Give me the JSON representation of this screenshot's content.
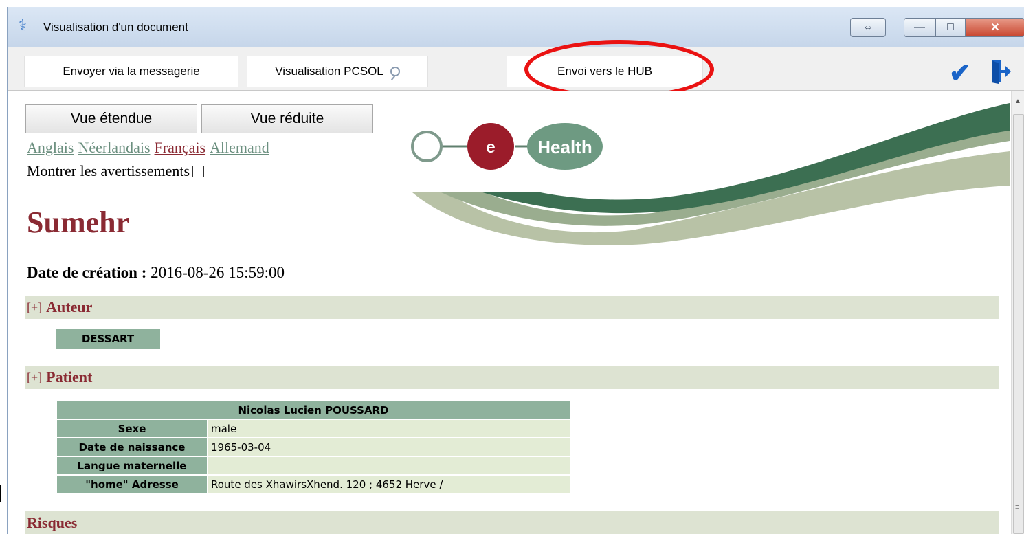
{
  "window": {
    "title": "Visualisation d'un document",
    "controls": {
      "resize": "⇔",
      "minimize": "—",
      "maximize": "□",
      "close": "✕"
    }
  },
  "toolbar": {
    "send_message": "Envoyer via la messagerie",
    "view_pcsol": "Visualisation PCSOL",
    "send_hub": "Envoi vers le HUB",
    "confirm_icon": "check-icon",
    "exit_icon": "exit-icon"
  },
  "annotation": {
    "color": "#ea1212",
    "target": "send_hub"
  },
  "view_buttons": {
    "extended": "Vue étendue",
    "reduced": "Vue réduite"
  },
  "languages": [
    {
      "label": "Anglais",
      "active": false
    },
    {
      "label": "Néerlandais",
      "active": false
    },
    {
      "label": "Français",
      "active": true
    },
    {
      "label": "Allemand",
      "active": false
    }
  ],
  "warnings": {
    "label": "Montrer les avertissements",
    "checked": false
  },
  "logo": {
    "letter": "e",
    "brand": "Health"
  },
  "document": {
    "title": "Sumehr",
    "creation_label": "Date de création :",
    "creation_value": "2016-08-26 15:59:00"
  },
  "sections": {
    "author": {
      "toggle": "[+]",
      "label": "Auteur",
      "value": "DESSART"
    },
    "patient": {
      "toggle": "[+]",
      "label": "Patient"
    },
    "risks": {
      "label": "Risques"
    }
  },
  "patient": {
    "name": "Nicolas Lucien POUSSARD",
    "rows": [
      {
        "key": "Sexe",
        "value": "male"
      },
      {
        "key": "Date de naissance",
        "value": "1965-03-04"
      },
      {
        "key": "Langue maternelle",
        "value": ""
      },
      {
        "key": "\"home\" Adresse",
        "value": "Route des XhawirsXhend. 120 ; 4652 Herve /"
      }
    ]
  },
  "colors": {
    "accent_red": "#8a2a33",
    "header_green": "#8fb29d",
    "row_green": "#e3ecd5",
    "section_bg": "#dde3d2",
    "link_green": "#6b8f7f"
  }
}
